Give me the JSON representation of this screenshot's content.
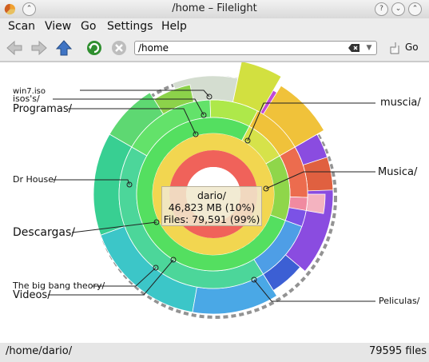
{
  "window": {
    "title": "/home – Filelight"
  },
  "menu": [
    "Scan",
    "View",
    "Go",
    "Settings",
    "Help"
  ],
  "address": {
    "value": "/home",
    "go_label": "Go"
  },
  "tooltip": {
    "name": "dario/",
    "size": "46,823 MB (10%)",
    "files": "Files: 79,591 (99%)"
  },
  "labels": {
    "win7": "win7.iso",
    "isos": "isos's/",
    "programas": "Programas/",
    "drhouse": "Dr House/",
    "descargas": "Descargas/",
    "bigbang": "The big bang theory/",
    "videos": "Videos/",
    "muscia": "muscia/",
    "musica": "Musica/",
    "peliculas": "Peliculas/"
  },
  "status": {
    "path": "/home/dario/",
    "files": "79595 files"
  },
  "icons": [
    "filelight-app-icon",
    "pin-icon",
    "help-icon",
    "minimize-icon",
    "maximize-icon",
    "close-icon",
    "back-icon",
    "forward-icon",
    "up-icon",
    "refresh-icon",
    "stop-icon",
    "clear-location-icon",
    "chevron-down-icon",
    "go-icon"
  ]
}
